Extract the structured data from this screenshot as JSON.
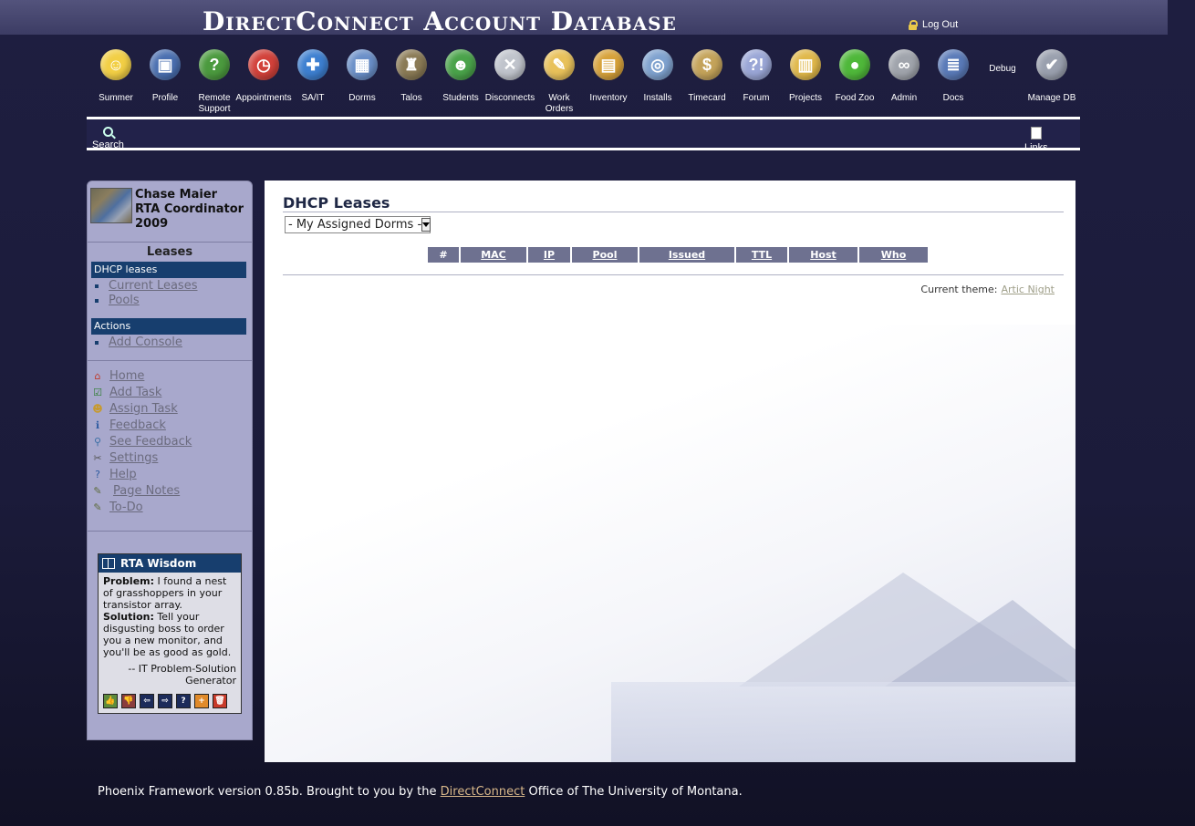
{
  "header": {
    "title": "DirectConnect Account Database",
    "logout_label": "Log Out"
  },
  "nav": [
    {
      "name": "nav-summer",
      "label": "Summer",
      "icon": "sunglasses-face-icon",
      "color": "#f2cf45",
      "glyph": "☺"
    },
    {
      "name": "nav-profile",
      "label": "Profile",
      "icon": "profile-card-icon",
      "color": "#4a6fb0",
      "glyph": "▣"
    },
    {
      "name": "nav-remote-support",
      "label": "Remote Support",
      "icon": "globe-help-icon",
      "color": "#4b9a3e",
      "glyph": "?"
    },
    {
      "name": "nav-appointments",
      "label": "Appointments",
      "icon": "alarm-clock-icon",
      "color": "#d2413a",
      "glyph": "◷"
    },
    {
      "name": "nav-sa-it",
      "label": "SA/IT",
      "icon": "first-aid-icon",
      "color": "#3d7fd0",
      "glyph": "✚"
    },
    {
      "name": "nav-dorms",
      "label": "Dorms",
      "icon": "building-icon",
      "color": "#6a8fc8",
      "glyph": "▦"
    },
    {
      "name": "nav-talos",
      "label": "Talos",
      "icon": "helmet-icon",
      "color": "#8a7a55",
      "glyph": "♜"
    },
    {
      "name": "nav-students",
      "label": "Students",
      "icon": "person-icon",
      "color": "#4aa34a",
      "glyph": "☻"
    },
    {
      "name": "nav-disconnects",
      "label": "Disconnects",
      "icon": "disconnect-cable-icon",
      "color": "#c0c4cc",
      "glyph": "✕"
    },
    {
      "name": "nav-work-orders",
      "label": "Work Orders",
      "icon": "pinned-note-icon",
      "color": "#e8c15a",
      "glyph": "✎"
    },
    {
      "name": "nav-inventory",
      "label": "Inventory",
      "icon": "box-icon",
      "color": "#d7a23a",
      "glyph": "▤"
    },
    {
      "name": "nav-installs",
      "label": "Installs",
      "icon": "install-disc-icon",
      "color": "#7fa2cf",
      "glyph": "◎"
    },
    {
      "name": "nav-timecard",
      "label": "Timecard",
      "icon": "money-bag-icon",
      "color": "#c4a35a",
      "glyph": "$"
    },
    {
      "name": "nav-forum",
      "label": "Forum",
      "icon": "speech-bubbles-icon",
      "color": "#9aa6d6",
      "glyph": "?!"
    },
    {
      "name": "nav-projects",
      "label": "Projects",
      "icon": "folders-icon",
      "color": "#e0b84a",
      "glyph": "▥"
    },
    {
      "name": "nav-food-zoo",
      "label": "Food Zoo",
      "icon": "apple-icon",
      "color": "#4fb83a",
      "glyph": "●"
    },
    {
      "name": "nav-admin",
      "label": "Admin",
      "icon": "handcuffs-icon",
      "color": "#a0a4ac",
      "glyph": "∞"
    },
    {
      "name": "nav-docs",
      "label": "Docs",
      "icon": "books-icon",
      "color": "#5a7ab8",
      "glyph": "≣"
    },
    {
      "name": "nav-debug",
      "label": "Debug",
      "icon": "",
      "color": "transparent",
      "glyph": ""
    },
    {
      "name": "nav-manage-db",
      "label": "Manage DB",
      "icon": "database-check-icon",
      "color": "#9aa0ae",
      "glyph": "✔"
    }
  ],
  "subnav": {
    "search_label": "Search",
    "links_label": "Links"
  },
  "sidebar": {
    "user_name": "Chase Maier",
    "user_role": "RTA Coordinator",
    "user_year": "2009",
    "section_heading": "Leases",
    "dhcp_heading": "DHCP leases",
    "dhcp_links": [
      "Current Leases",
      "Pools"
    ],
    "actions_heading": "Actions",
    "action_links": [
      "Add Console"
    ],
    "quick_links": [
      {
        "label": "Home",
        "icon": "home-icon"
      },
      {
        "label": "Add Task",
        "icon": "checkbox-icon"
      },
      {
        "label": "Assign Task",
        "icon": "assign-person-icon"
      },
      {
        "label": "Feedback",
        "icon": "info-icon"
      },
      {
        "label": "See Feedback",
        "icon": "magnifier-icon"
      },
      {
        "label": "Settings",
        "icon": "tools-icon"
      },
      {
        "label": "Help",
        "icon": "help-icon"
      },
      {
        "label": "Page Notes",
        "icon": "notepad-icon"
      },
      {
        "label": "To-Do",
        "icon": "notepad-check-icon"
      }
    ]
  },
  "wisdom": {
    "title": "RTA Wisdom",
    "problem_label": "Problem:",
    "problem_text": "I found a nest of grasshoppers in your transistor array.",
    "solution_label": "Solution:",
    "solution_text": "Tell your disgusting boss to order you a new monitor, and you'll be as good as gold.",
    "attribution": "-- IT Problem-Solution Generator",
    "buttons": [
      {
        "name": "thumbs-up-button",
        "icon": "thumbs-up-icon",
        "glyph": "👍",
        "color": "#5d8a3c"
      },
      {
        "name": "thumbs-down-button",
        "icon": "thumbs-down-icon",
        "glyph": "👎",
        "color": "#8a3c3c"
      },
      {
        "name": "previous-button",
        "icon": "arrow-left-icon",
        "glyph": "⇦",
        "color": "#1c2b5a"
      },
      {
        "name": "next-button",
        "icon": "arrow-right-icon",
        "glyph": "⇨",
        "color": "#1c2b5a"
      },
      {
        "name": "help-button",
        "icon": "question-icon",
        "glyph": "?",
        "color": "#1c2b5a"
      },
      {
        "name": "add-button",
        "icon": "plus-icon",
        "glyph": "+",
        "color": "#e08a2a"
      },
      {
        "name": "delete-button",
        "icon": "trash-icon",
        "glyph": "🗑",
        "color": "#c83a2a"
      }
    ]
  },
  "main": {
    "page_title": "DHCP Leases",
    "dorm_select_value": "- My Assigned Dorms -",
    "table_headers": [
      "#",
      "MAC",
      "IP",
      "Pool",
      "Issued",
      "TTL",
      "Host",
      "Who"
    ],
    "theme_label": "Current theme:",
    "theme_value": "Artic Night"
  },
  "footer": {
    "prefix": "Phoenix Framework version 0.85b. Brought to you by the",
    "link": "DirectConnect",
    "suffix": "Office of The University of Montana."
  }
}
